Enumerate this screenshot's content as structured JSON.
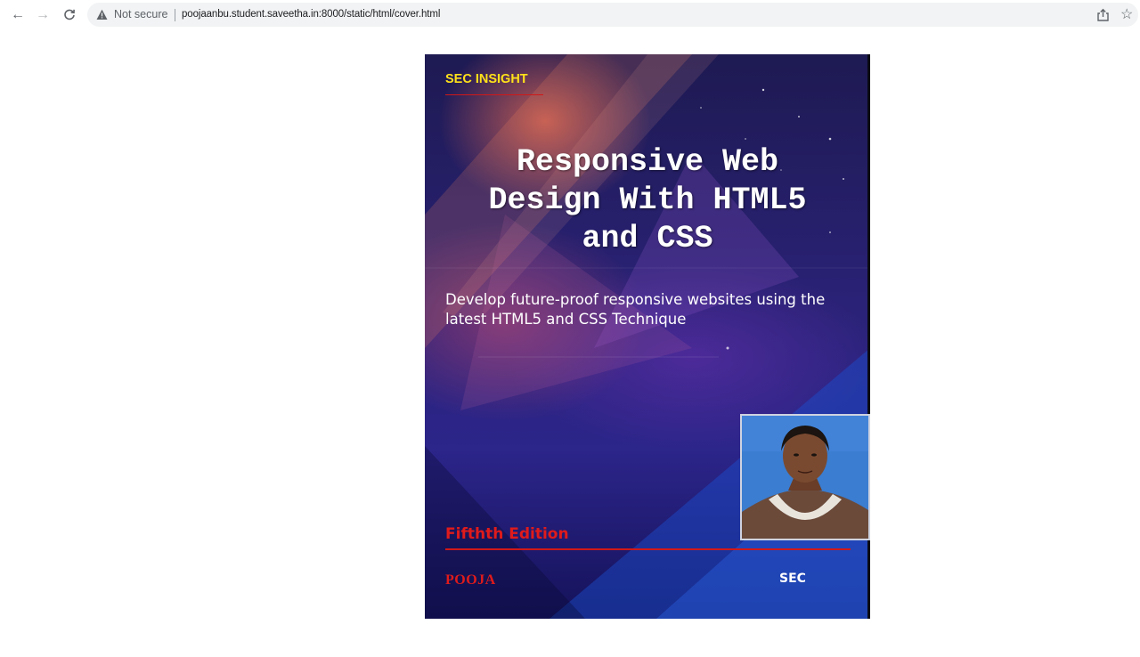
{
  "browser": {
    "back_icon": "arrow-left-icon",
    "forward_icon": "arrow-right-icon",
    "reload_icon": "reload-icon",
    "security_label": "Not secure",
    "url": "poojaanbu.student.saveetha.in:8000/static/html/cover.html",
    "share_icon": "share-icon",
    "bookmark_icon": "star-icon"
  },
  "cover": {
    "brand": "SEC INSIGHT",
    "title_lines": [
      "Responsive Web",
      "Design With HTML5",
      "and CSS"
    ],
    "subtitle": "Develop future-proof responsive websites using the latest HTML5 and CSS Technique",
    "edition": "Fifthth Edition",
    "author": "POOJA",
    "publisher": "SEC",
    "colors": {
      "brand": "#ffe11a",
      "accent_red": "#e01b1b",
      "background_dark": "#1e1a52",
      "background_blue": "#2c258a"
    }
  }
}
